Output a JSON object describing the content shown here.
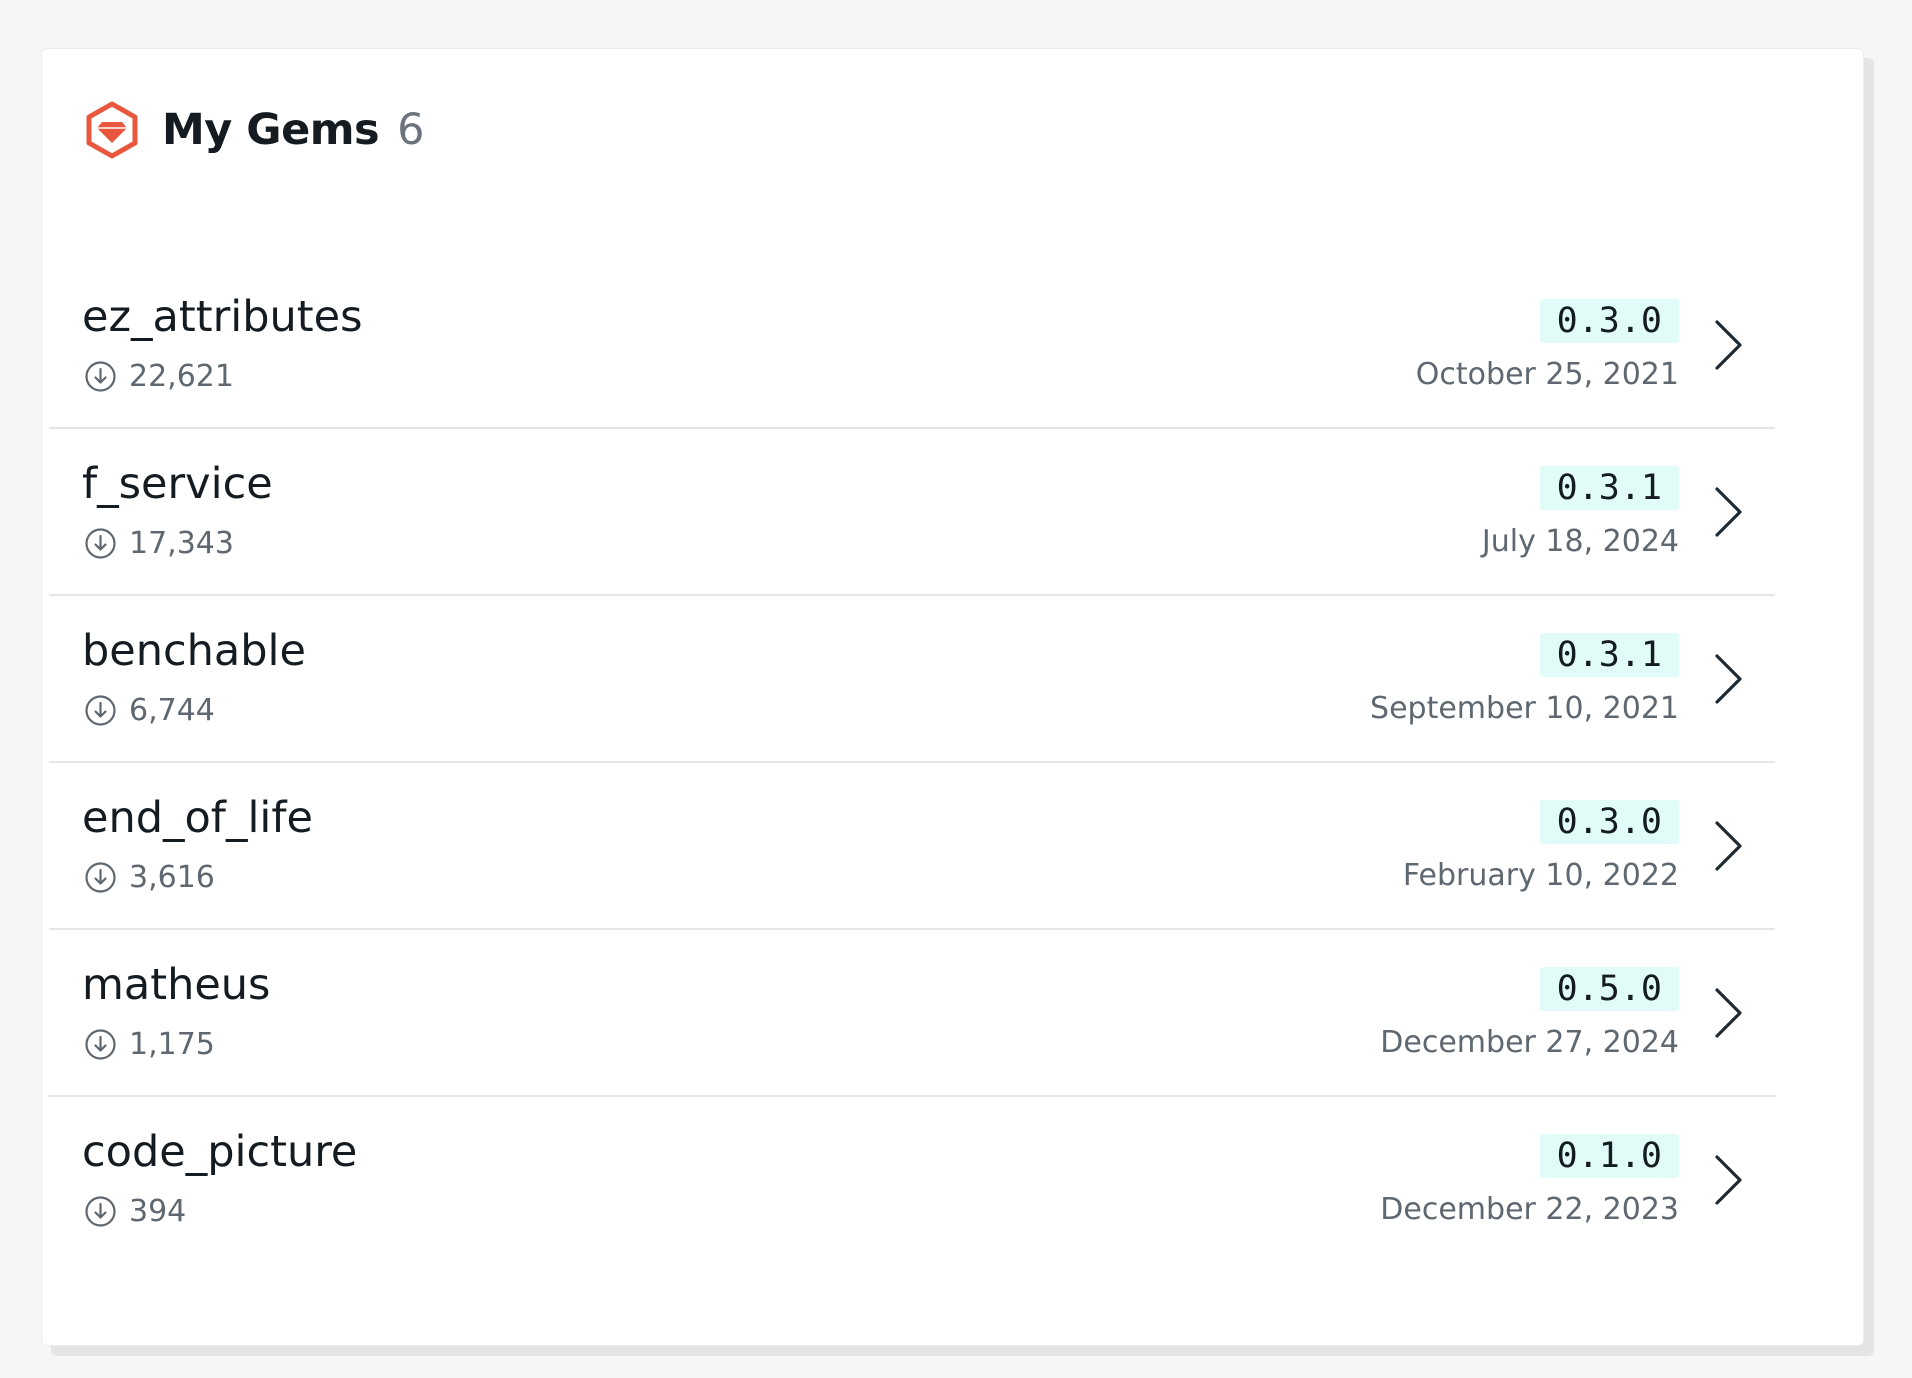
{
  "header": {
    "title": "My Gems",
    "count": "6",
    "logo_icon": "rubygems-gem-icon",
    "logo_color": "#e9573f"
  },
  "gems": [
    {
      "name": "ez_attributes",
      "downloads": "22,621",
      "version": "0.3.0",
      "date": "October 25, 2021"
    },
    {
      "name": "f_service",
      "downloads": "17,343",
      "version": "0.3.1",
      "date": "July 18, 2024"
    },
    {
      "name": "benchable",
      "downloads": "6,744",
      "version": "0.3.1",
      "date": "September 10, 2021"
    },
    {
      "name": "end_of_life",
      "downloads": "3,616",
      "version": "0.3.0",
      "date": "February 10, 2022"
    },
    {
      "name": "matheus",
      "downloads": "1,175",
      "version": "0.5.0",
      "date": "December 27, 2024"
    },
    {
      "name": "code_picture",
      "downloads": "394",
      "version": "0.1.0",
      "date": "December 22, 2023"
    }
  ],
  "colors": {
    "version_badge_bg": "#e0fbf8",
    "text_primary": "#141c22",
    "text_secondary": "#5f6870"
  }
}
